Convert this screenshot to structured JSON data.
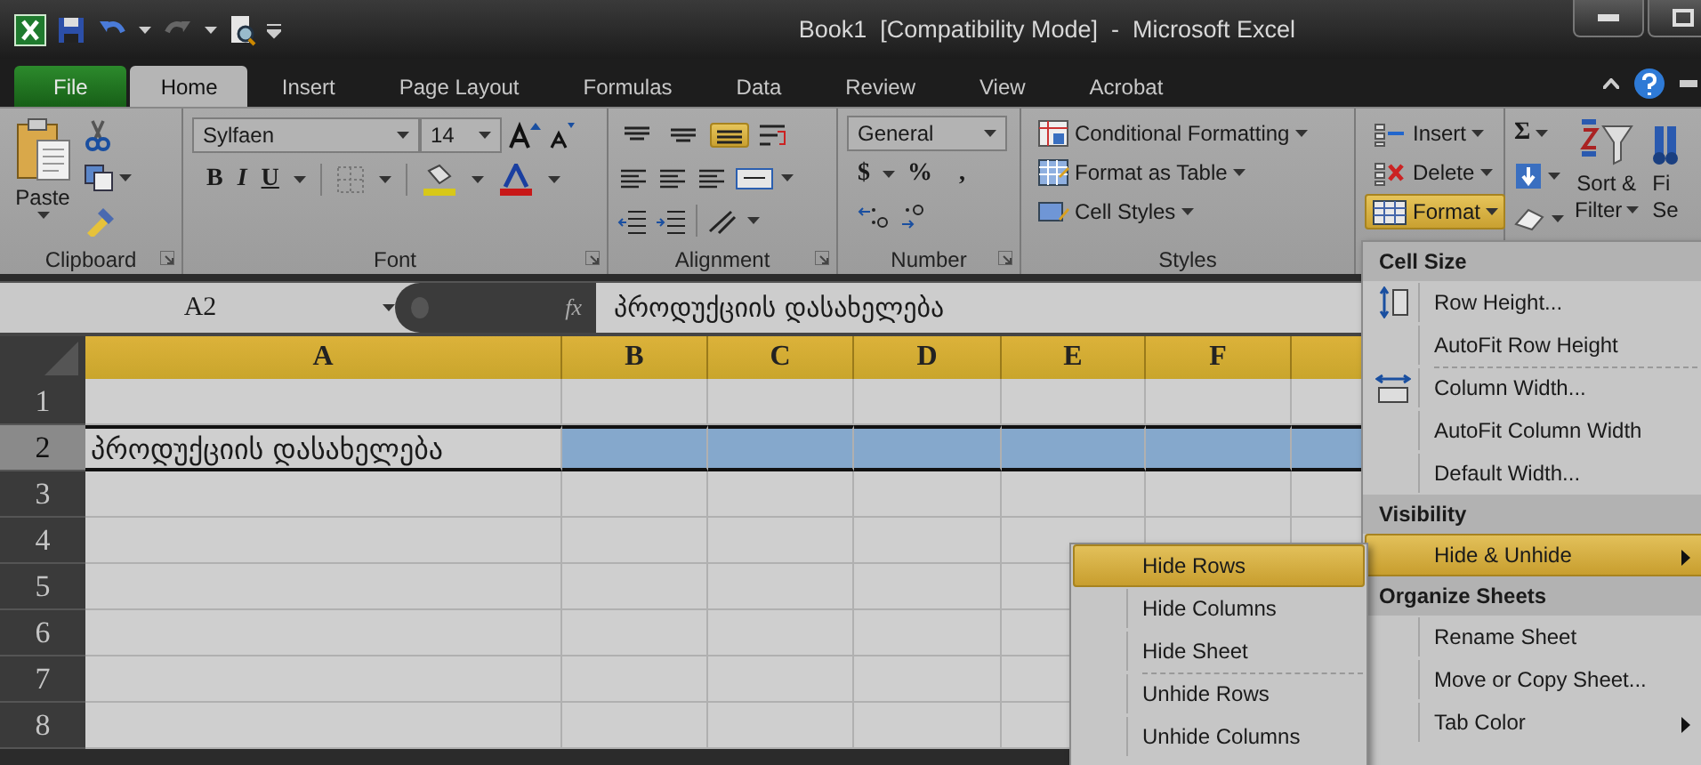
{
  "window": {
    "title": "Book1  [Compatibility Mode]  -  Microsoft Excel"
  },
  "tabs": [
    {
      "label": "File",
      "kind": "file",
      "selected": false
    },
    {
      "label": "Home",
      "kind": "tab",
      "selected": true
    },
    {
      "label": "Insert",
      "kind": "tab",
      "selected": false
    },
    {
      "label": "Page Layout",
      "kind": "tab",
      "selected": false
    },
    {
      "label": "Formulas",
      "kind": "tab",
      "selected": false
    },
    {
      "label": "Data",
      "kind": "tab",
      "selected": false
    },
    {
      "label": "Review",
      "kind": "tab",
      "selected": false
    },
    {
      "label": "View",
      "kind": "tab",
      "selected": false
    },
    {
      "label": "Acrobat",
      "kind": "tab",
      "selected": false
    }
  ],
  "ribbon": {
    "clipboard": {
      "paste": "Paste",
      "label": "Clipboard"
    },
    "font": {
      "name": "Sylfaen",
      "size": "14",
      "bold": "B",
      "italic": "I",
      "underline": "U",
      "label": "Font"
    },
    "alignment": {
      "vertical": [
        {
          "kind": "top",
          "selected": false
        },
        {
          "kind": "middle",
          "selected": false
        },
        {
          "kind": "bottom",
          "selected": true
        }
      ],
      "label": "Alignment"
    },
    "number": {
      "format": "General",
      "currency": "$",
      "percent": "%",
      "comma": ",",
      "label": "Number"
    },
    "styles": {
      "items": [
        "Conditional Formatting",
        "Format as Table",
        "Cell Styles"
      ],
      "label": "Styles"
    },
    "cells": {
      "items": [
        {
          "label": "Insert",
          "kind": "insert",
          "selected": false
        },
        {
          "label": "Delete",
          "kind": "delete",
          "selected": false
        },
        {
          "label": "Format",
          "kind": "format",
          "selected": true
        }
      ]
    },
    "editing": {
      "sum": "Σ",
      "sort": [
        "Sort &",
        "Filter"
      ],
      "find": [
        "Fi",
        "Se"
      ]
    }
  },
  "formula_bar": {
    "name_box": "A2",
    "fx": "fx",
    "value": "პროდუქციის დასახელება"
  },
  "sheet": {
    "columns": [
      "A",
      "B",
      "C",
      "D",
      "E",
      "F"
    ],
    "rows": [
      {
        "label": "1",
        "selected": false
      },
      {
        "label": "2",
        "selected": true,
        "values": [
          "პროდუქციის დასახელება"
        ]
      },
      {
        "label": "3",
        "selected": false
      },
      {
        "label": "4",
        "selected": false
      },
      {
        "label": "5",
        "selected": false
      },
      {
        "label": "6",
        "selected": false
      },
      {
        "label": "7",
        "selected": false
      },
      {
        "label": "8",
        "selected": false
      }
    ]
  },
  "format_menu": {
    "sections": [
      {
        "title": "Cell Size",
        "items": [
          {
            "label": "Row Height...",
            "kind": "row_height",
            "selected": false,
            "separator_before": false
          },
          {
            "label": "AutoFit Row Height",
            "kind": "plain",
            "selected": false,
            "separator_before": false
          },
          {
            "label": "Column Width...",
            "kind": "column_width",
            "selected": false,
            "separator_before": true
          },
          {
            "label": "AutoFit Column Width",
            "kind": "plain",
            "selected": false,
            "separator_before": false
          },
          {
            "label": "Default Width...",
            "kind": "plain",
            "selected": false,
            "separator_before": false
          }
        ]
      },
      {
        "title": "Visibility",
        "items": [
          {
            "label": "Hide & Unhide",
            "kind": "submenu",
            "selected": true,
            "separator_before": false
          }
        ]
      },
      {
        "title": "Organize Sheets",
        "items": [
          {
            "label": "Rename Sheet",
            "kind": "plain",
            "selected": false,
            "separator_before": false
          },
          {
            "label": "Move or Copy Sheet...",
            "kind": "plain",
            "selected": false,
            "separator_before": false
          },
          {
            "label": "Tab Color",
            "kind": "submenu",
            "selected": false,
            "separator_before": false
          }
        ]
      }
    ]
  },
  "submenu": {
    "items": [
      {
        "label": "Hide Rows",
        "selected": true,
        "separator_before": false
      },
      {
        "label": "Hide Columns",
        "selected": false,
        "separator_before": false
      },
      {
        "label": "Hide Sheet",
        "selected": false,
        "separator_before": false
      },
      {
        "label": "Unhide Rows",
        "selected": false,
        "separator_before": true
      },
      {
        "label": "Unhide Columns",
        "selected": false,
        "separator_before": false
      }
    ]
  }
}
